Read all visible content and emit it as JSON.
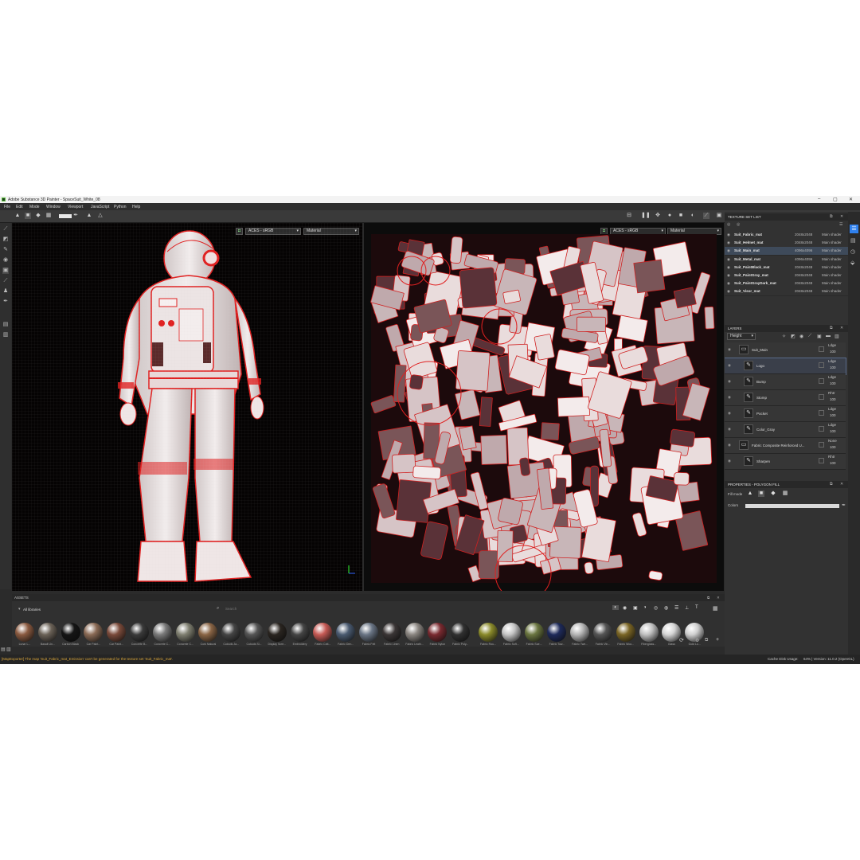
{
  "window": {
    "title": "Adobe Substance 3D Painter - SpaceSuit_White_08",
    "controls": [
      "–",
      "▢",
      "✕"
    ]
  },
  "menu": [
    "File",
    "Edit",
    "Mode",
    "Window",
    "Viewport",
    "JavaScript",
    "Python",
    "Help"
  ],
  "viewport_3d": {
    "colorspace": "ACES - sRGB",
    "channel": "Material"
  },
  "viewport_2d": {
    "colorspace": "ACES - sRGB",
    "channel": "Material"
  },
  "texture_set_list": {
    "title": "TEXTURE SET LIST",
    "rows": [
      {
        "name": "Suit_Fabric_mat",
        "size": "2048x2048",
        "shader": "Main shader"
      },
      {
        "name": "Suit_Helmet_mat",
        "size": "2048x2048",
        "shader": "Main shader"
      },
      {
        "name": "Suit_Main_mat",
        "size": "4096x4096",
        "shader": "Main shader"
      },
      {
        "name": "Suit_Metal_mat",
        "size": "4096x4096",
        "shader": "Main shader"
      },
      {
        "name": "Suit_PaintBlack_mat",
        "size": "2048x2048",
        "shader": "Main shader"
      },
      {
        "name": "Suit_PaintGray_mat",
        "size": "2048x2048",
        "shader": "Main shader"
      },
      {
        "name": "Suit_PaintGrayDark_mat",
        "size": "2048x2048",
        "shader": "Main shader"
      },
      {
        "name": "Suit_Visor_mat",
        "size": "2048x2048",
        "shader": "Main shader"
      }
    ]
  },
  "layers": {
    "title": "LAYERS",
    "channel": "Height",
    "rows": [
      {
        "name": "Suit_Main",
        "blend": "Ldge",
        "opacity": "100",
        "thumb": "▭"
      },
      {
        "name": "Logo",
        "blend": "Ldge",
        "opacity": "100",
        "thumb": "✎"
      },
      {
        "name": "Bump",
        "blend": "Ldge",
        "opacity": "100",
        "thumb": "✎"
      },
      {
        "name": "Stomp",
        "blend": "Rhtr",
        "opacity": "100",
        "thumb": "✎"
      },
      {
        "name": "Pocket",
        "blend": "Ldge",
        "opacity": "100",
        "thumb": "✎"
      },
      {
        "name": "Color_Gray",
        "blend": "Ldge",
        "opacity": "100",
        "thumb": "✎"
      },
      {
        "name": "Fabric Composite Reinforced U...",
        "blend": "None",
        "opacity": "100",
        "thumb": "▭"
      },
      {
        "name": "Sharpen",
        "blend": "Rhtr",
        "opacity": "100",
        "thumb": "✎"
      }
    ]
  },
  "properties": {
    "title": "PROPERTIES - POLYGON FILL",
    "fill_mode_label": "Fill mode",
    "colors_label": "Colors"
  },
  "assets": {
    "title": "ASSETS",
    "library": "All libraries",
    "search_placeholder": "Search",
    "items": [
      {
        "label": "Lunar L...",
        "color": "#8a5a40"
      },
      {
        "label": "Basalt Un...",
        "color": "#6b6257"
      },
      {
        "label": "Carbon Black",
        "color": "#151515"
      },
      {
        "label": "Car Paint...",
        "color": "#8a6a55"
      },
      {
        "label": "Car Paint...",
        "color": "#7a4a3a"
      },
      {
        "label": "Concrete B...",
        "color": "#3a3a3a"
      },
      {
        "label": "Concrete C...",
        "color": "#7a7a7a"
      },
      {
        "label": "Concrete C...",
        "color": "#7f7f70"
      },
      {
        "label": "Cork Natural",
        "color": "#8a6545"
      },
      {
        "label": "Cutouts Ja...",
        "color": "#444444"
      },
      {
        "label": "Cutouts Si...",
        "color": "#555555"
      },
      {
        "label": "Display Scre...",
        "color": "#2a2520"
      },
      {
        "label": "Embroidery",
        "color": "#444444"
      },
      {
        "label": "Fabric Cott...",
        "color": "#c65a55"
      },
      {
        "label": "Fabric Den...",
        "color": "#4a5a70"
      },
      {
        "label": "Fabric Felt",
        "color": "#6a7585"
      },
      {
        "label": "Fabric Linen",
        "color": "#3a3535"
      },
      {
        "label": "Fabric Leath...",
        "color": "#8a8580"
      },
      {
        "label": "Fabric Nylon",
        "color": "#7a2a30"
      },
      {
        "label": "Fabric Poly...",
        "color": "#303030"
      },
      {
        "label": "Fabric Rou...",
        "color": "#8a8a2a"
      },
      {
        "label": "Fabric Soft...",
        "color": "#c5c5c5"
      },
      {
        "label": "Fabric Sue...",
        "color": "#6a7540"
      },
      {
        "label": "Fabric Tow...",
        "color": "#1e2a5a"
      },
      {
        "label": "Fabric Twe...",
        "color": "#b5b5b5"
      },
      {
        "label": "Fabric Vin...",
        "color": "#555555"
      },
      {
        "label": "Fabric Woo...",
        "color": "#7a6525"
      },
      {
        "label": "Fiberglass...",
        "color": "#c0c0c0"
      },
      {
        "label": "Glass",
        "color": "#d5d5d5"
      },
      {
        "label": "Gold Lo...",
        "color": "#cfcfcf"
      }
    ]
  },
  "status": {
    "message": "[MapExporter] The map 'Suit_Fabric_mat_Emission' can't be generated for the texture set 'Suit_Fabric_mat'.",
    "cache": "Cache Disk Usage:",
    "version": "64% | Version: 11.0.2 (OpenGL)"
  },
  "colors": {
    "accent": "#2f80ed",
    "wire": "#e02020",
    "status_warning": "#d9a53a"
  }
}
